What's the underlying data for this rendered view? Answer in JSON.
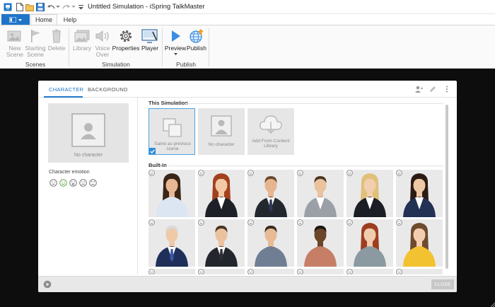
{
  "window": {
    "title": "Untitled Simulation - iSpring TalkMaster"
  },
  "ribbon_tabs": [
    {
      "label": "Home"
    },
    {
      "label": "Help"
    }
  ],
  "ribbon": {
    "groups": [
      {
        "label": "Scenes"
      },
      {
        "label": "Simulation"
      },
      {
        "label": "Publish"
      }
    ],
    "buttons": {
      "new_scene": "New\nScene",
      "starting_scene": "Starting\nScene",
      "delete": "Delete",
      "library": "Library",
      "voice_over": "Voice\nOver",
      "properties": "Properties",
      "player": "Player",
      "preview": "Preview",
      "publish": "Publish"
    }
  },
  "dialog": {
    "tabs": [
      {
        "label": "CHARACTER"
      },
      {
        "label": "BACKGROUND"
      }
    ],
    "left": {
      "no_character": "No character",
      "emotion_title": "Character emotion",
      "emotions": [
        "neutral",
        "happy",
        "surprised",
        "sad",
        "angry"
      ]
    },
    "sections": {
      "this_simulation": "This Simulation",
      "built_in": "Built-In"
    },
    "sim_tiles": [
      {
        "label": "Same as previous scene"
      },
      {
        "label": "No character"
      },
      {
        "label": "Add From Content Library"
      }
    ],
    "characters": [
      {
        "skin": "#e7b894",
        "hair": "#3a2516",
        "long": true,
        "top": "#dce6f2",
        "jacket": "#dce6f2",
        "tie": "",
        "bg": "#e9e9ea"
      },
      {
        "skin": "#f1c9a6",
        "hair": "#a3401d",
        "long": true,
        "top": "#ffffff",
        "jacket": "#1e2027",
        "tie": "",
        "bg": "#e9e9ea"
      },
      {
        "skin": "#e6b690",
        "hair": "#6b4a2d",
        "long": false,
        "top": "#ffffff",
        "jacket": "#23282f",
        "tie": "#2d3a52",
        "bg": "#e9e9ea"
      },
      {
        "skin": "#eac29d",
        "hair": "#4d3524",
        "long": false,
        "top": "#ffffff",
        "jacket": "#9aa0a6",
        "tie": "",
        "bg": "#e9e9ea"
      },
      {
        "skin": "#f2cfae",
        "hair": "#e0c17a",
        "long": true,
        "top": "#ffffff",
        "jacket": "#1b1e25",
        "tie": "",
        "bg": "#e9e9ea"
      },
      {
        "skin": "#edc8a5",
        "hair": "#2c1b12",
        "long": true,
        "top": "#ffffff",
        "jacket": "#223154",
        "tie": "",
        "bg": "#e9e9ea"
      },
      {
        "skin": "#f0c9a8",
        "hair": "#d9d9d9",
        "long": false,
        "top": "#ffffff",
        "jacket": "#1f2f5a",
        "tie": "#3a5aa8",
        "bg": "#e9e9ea"
      },
      {
        "skin": "#eac39e",
        "hair": "#4a3322",
        "long": false,
        "top": "#ffffff",
        "jacket": "#23262c",
        "tie": "#2c2f36",
        "bg": "#e9e9ea"
      },
      {
        "skin": "#e7bb95",
        "hair": "#3c2a1d",
        "long": false,
        "top": "#6f7e93",
        "jacket": "#6f7e93",
        "tie": "",
        "bg": "#e9e9ea"
      },
      {
        "skin": "#6b4429",
        "hair": "#1b1410",
        "long": false,
        "top": "#c77e67",
        "jacket": "#c77e67",
        "tie": "",
        "bg": "#e9e9ea"
      },
      {
        "skin": "#f1cbad",
        "hair": "#9c3e1f",
        "long": true,
        "top": "#8a9aa0",
        "jacket": "#8a9aa0",
        "tie": "",
        "bg": "#e9e9ea"
      },
      {
        "skin": "#f2cdb0",
        "hair": "#6e4a2e",
        "long": true,
        "top": "#f2c230",
        "jacket": "#f2c230",
        "tie": "",
        "bg": "#e9e9ea"
      },
      {
        "skin": "#e2b38e",
        "hair": "#2b1d14",
        "long": false,
        "top": "#2d2d2d",
        "jacket": "#2d2d2d",
        "tie": "",
        "bg": "#e9e9ea"
      },
      {
        "skin": "#e8bc97",
        "hair": "#5a3d27",
        "long": false,
        "top": "#333",
        "jacket": "#333",
        "tie": "",
        "bg": "#e9e9ea"
      },
      {
        "skin": "#e5b792",
        "hair": "#2e2018",
        "long": false,
        "top": "#333",
        "jacket": "#333",
        "tie": "",
        "bg": "#e9e9ea"
      },
      {
        "skin": "#7a4c2e",
        "hair": "#1a1310",
        "long": false,
        "top": "#333",
        "jacket": "#333",
        "tie": "",
        "bg": "#e9e9ea"
      },
      {
        "skin": "#eec6a3",
        "hair": "#3a271b",
        "long": false,
        "top": "#333",
        "jacket": "#333",
        "tie": "",
        "bg": "#e9e9ea"
      },
      {
        "skin": "#ecc3a0",
        "hair": "#5e3f28",
        "long": false,
        "top": "#333",
        "jacket": "#333",
        "tie": "",
        "bg": "#e9e9ea"
      }
    ],
    "close_label": "CLOSE"
  },
  "colors": {
    "accent": "#1f74c8",
    "select_border": "#4fa3e0"
  }
}
